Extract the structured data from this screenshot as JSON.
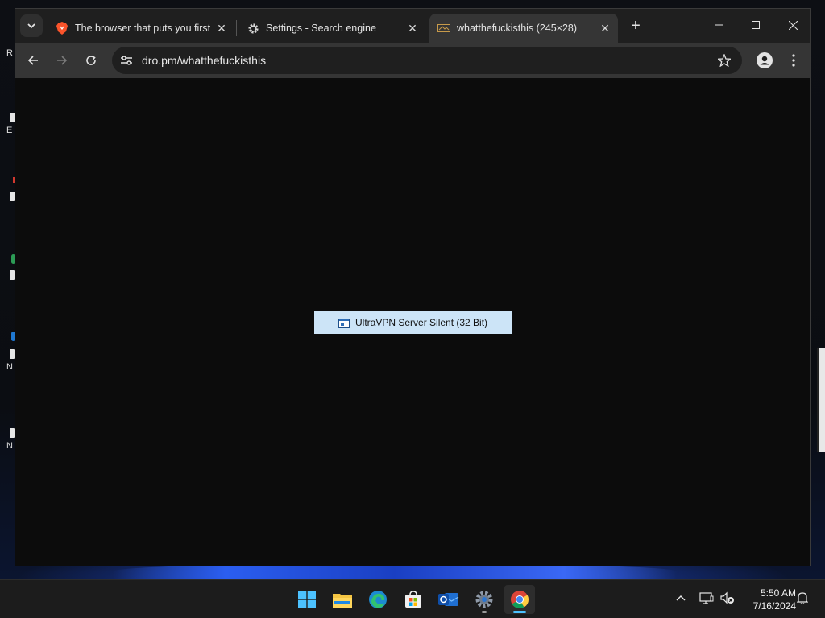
{
  "browser": {
    "tabs": [
      {
        "title": "The browser that puts you first",
        "favicon": "brave-lion-icon",
        "active": false
      },
      {
        "title": "Settings - Search engine",
        "favicon": "gear-icon",
        "active": false
      },
      {
        "title": "whatthefuckisthis (245×28)",
        "favicon": "image-icon",
        "active": true
      }
    ],
    "tab_close_symbol": "✕",
    "new_tab_symbol": "+",
    "address": "dro.pm/whatthefuckisthis",
    "window_controls": [
      "minimize-icon",
      "maximize-icon",
      "close-icon"
    ]
  },
  "content": {
    "image_text": "UltraVPN Server Silent (32 Bit)",
    "image_background": "#cce4f7"
  },
  "desktop": {
    "edge_letters": [
      "R",
      "E",
      "N",
      "N"
    ]
  },
  "taskbar": {
    "apps": [
      "windows-start-icon",
      "file-explorer-icon",
      "edge-icon",
      "microsoft-store-icon",
      "outlook-icon",
      "settings-icon",
      "chrome-icon"
    ],
    "time": "5:50 AM",
    "date": "7/16/2024"
  },
  "colors": {
    "tabstrip": "#1f1f1f",
    "toolbar": "#353535",
    "content_bg": "#0c0c0c",
    "taskbar": "#1c1c1c",
    "accent": "#4cc2ff"
  }
}
